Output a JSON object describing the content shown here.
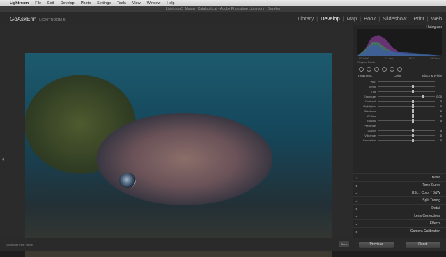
{
  "menubar": {
    "apple": "",
    "items": [
      "Lightroom",
      "File",
      "Edit",
      "Develop",
      "Photo",
      "Settings",
      "Tools",
      "View",
      "Window",
      "Help"
    ]
  },
  "window_title": "Lightroom5_Master_Catalog.lrcat - Adobe Photoshop Lightroom - Develop",
  "brand": {
    "name": "GoAskErin",
    "product": "LIGHTROOM 5"
  },
  "modules": [
    "Library",
    "Develop",
    "Map",
    "Book",
    "Slideshow",
    "Print",
    "Web"
  ],
  "active_module": "Develop",
  "panel": {
    "histogram_label": "Histogram",
    "histo_info": [
      "ISO 400",
      "17 mm",
      "f/5.0",
      "1/60 sec"
    ],
    "original_photo": "Original Photo",
    "basic": {
      "left": "Basic",
      "treatment": "Treatment:",
      "color": "Color",
      "bw": "Black & White"
    },
    "sliders": [
      {
        "label": "WB:",
        "value": ""
      },
      {
        "label": "Temp",
        "value": ""
      },
      {
        "label": "Tint",
        "value": ""
      },
      {
        "label": "Exposure",
        "value": "0.00"
      },
      {
        "label": "Contrast",
        "value": "0"
      },
      {
        "label": "Highlights",
        "value": "0"
      },
      {
        "label": "Shadows",
        "value": "0"
      },
      {
        "label": "Whites",
        "value": "0"
      },
      {
        "label": "Blacks",
        "value": "0"
      },
      {
        "label": "Presence",
        "value": ""
      },
      {
        "label": "Clarity",
        "value": "0"
      },
      {
        "label": "Vibrance",
        "value": "0"
      },
      {
        "label": "Saturation",
        "value": "0"
      }
    ],
    "sections": [
      "Basic",
      "Tone Curve",
      "HSL / Color / B&W",
      "Split Toning",
      "Detail",
      "Lens Corrections",
      "Effects",
      "Camera Calibration"
    ],
    "prev_button": "Previous",
    "reset_button": "Reset"
  },
  "toolbar": {
    "left": "Show Edit Pins:",
    "left_val": "Never",
    "right": "Done"
  }
}
